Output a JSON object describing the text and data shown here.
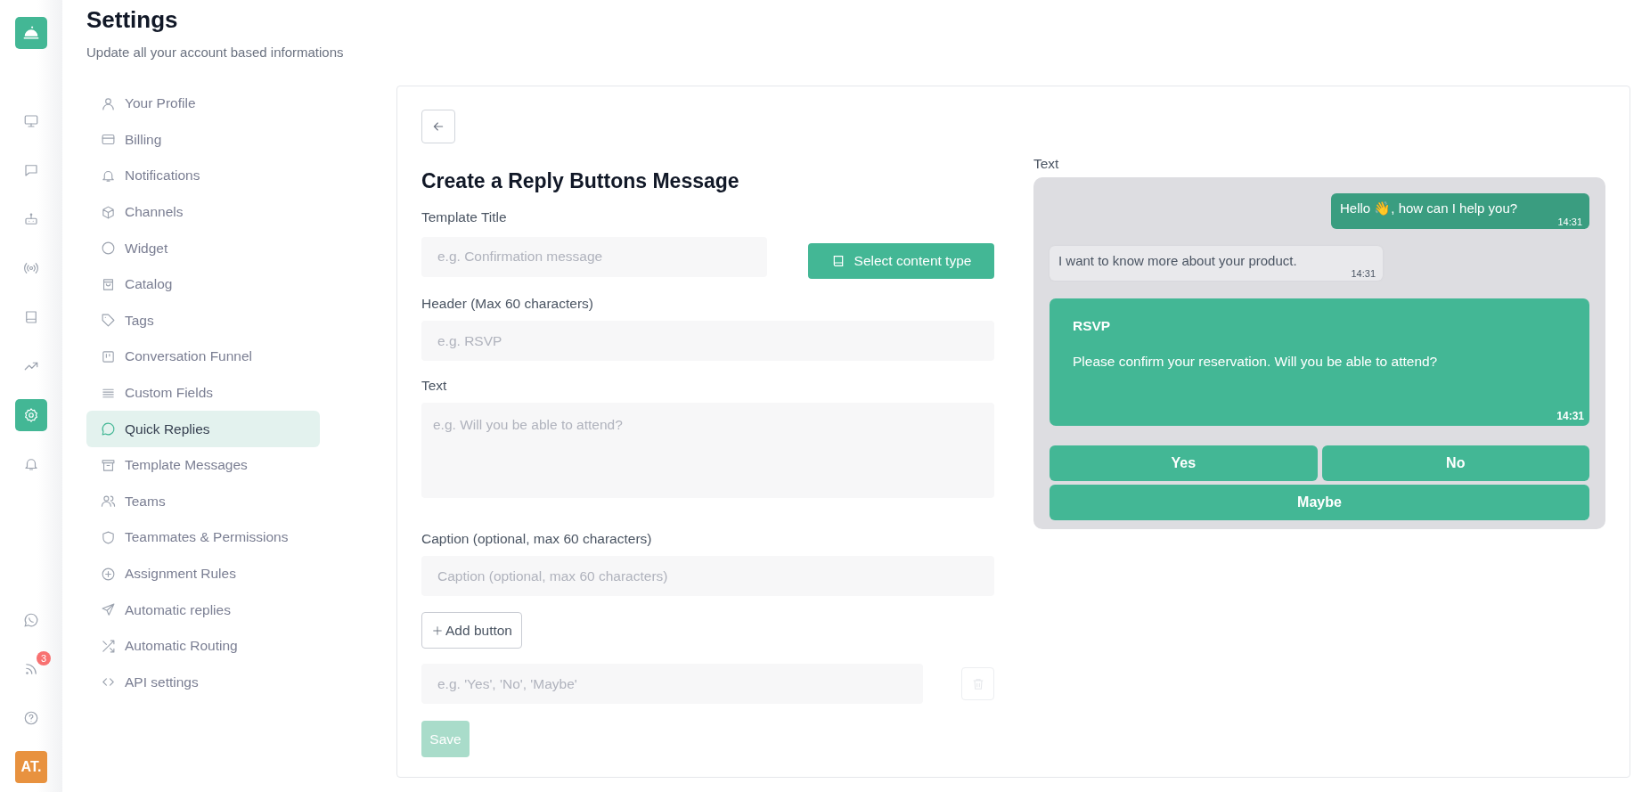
{
  "rail": {
    "items": [
      {
        "selected": false
      },
      {
        "selected": false
      },
      {
        "selected": false
      },
      {
        "selected": false
      },
      {
        "selected": false
      },
      {
        "selected": false
      },
      {
        "selected": true
      },
      {
        "selected": false
      }
    ],
    "feed_badge": "3",
    "avatar": "AT."
  },
  "header": {
    "title": "Settings",
    "subtitle": "Update all your account based informations"
  },
  "menu": [
    {
      "label": "Your Profile",
      "selected": false
    },
    {
      "label": "Billing",
      "selected": false
    },
    {
      "label": "Notifications",
      "selected": false
    },
    {
      "label": "Channels",
      "selected": false
    },
    {
      "label": "Widget",
      "selected": false
    },
    {
      "label": "Catalog",
      "selected": false
    },
    {
      "label": "Tags",
      "selected": false
    },
    {
      "label": "Conversation Funnel",
      "selected": false
    },
    {
      "label": "Custom Fields",
      "selected": false
    },
    {
      "label": "Quick Replies",
      "selected": true
    },
    {
      "label": "Template Messages",
      "selected": false
    },
    {
      "label": "Teams",
      "selected": false
    },
    {
      "label": "Teammates & Permissions",
      "selected": false
    },
    {
      "label": "Assignment Rules",
      "selected": false
    },
    {
      "label": "Automatic replies",
      "selected": false
    },
    {
      "label": "Automatic Routing",
      "selected": false
    },
    {
      "label": "API settings",
      "selected": false
    }
  ],
  "form": {
    "title": "Create a Reply Buttons Message",
    "template_title": {
      "label": "Template Title",
      "placeholder": "e.g. Confirmation message"
    },
    "select_content_type": "Select content type",
    "header": {
      "label": "Header (Max 60 characters)",
      "placeholder": "e.g. RSVP"
    },
    "text": {
      "label": "Text",
      "placeholder": "e.g. Will you be able to attend?"
    },
    "caption": {
      "label": "Caption (optional, max 60 characters)",
      "placeholder": "Caption (optional, max 60 characters)"
    },
    "add_button": "Add button",
    "button_option": {
      "placeholder": "e.g. 'Yes', 'No', 'Maybe'"
    },
    "save": {
      "label": "Save",
      "disabled": true
    }
  },
  "preview": {
    "label": "Text",
    "messages": [
      {
        "kind": "outgoing",
        "text": "Hello 👋, how can I help you?",
        "time": "14:31"
      },
      {
        "kind": "incoming",
        "text": "I want to know more about your product.",
        "time": "14:31"
      }
    ],
    "card": {
      "header": "RSVP",
      "body": "Please confirm your reservation. Will you be able to attend?",
      "time": "14:31"
    },
    "buttons": [
      "Yes",
      "No",
      "Maybe"
    ]
  }
}
